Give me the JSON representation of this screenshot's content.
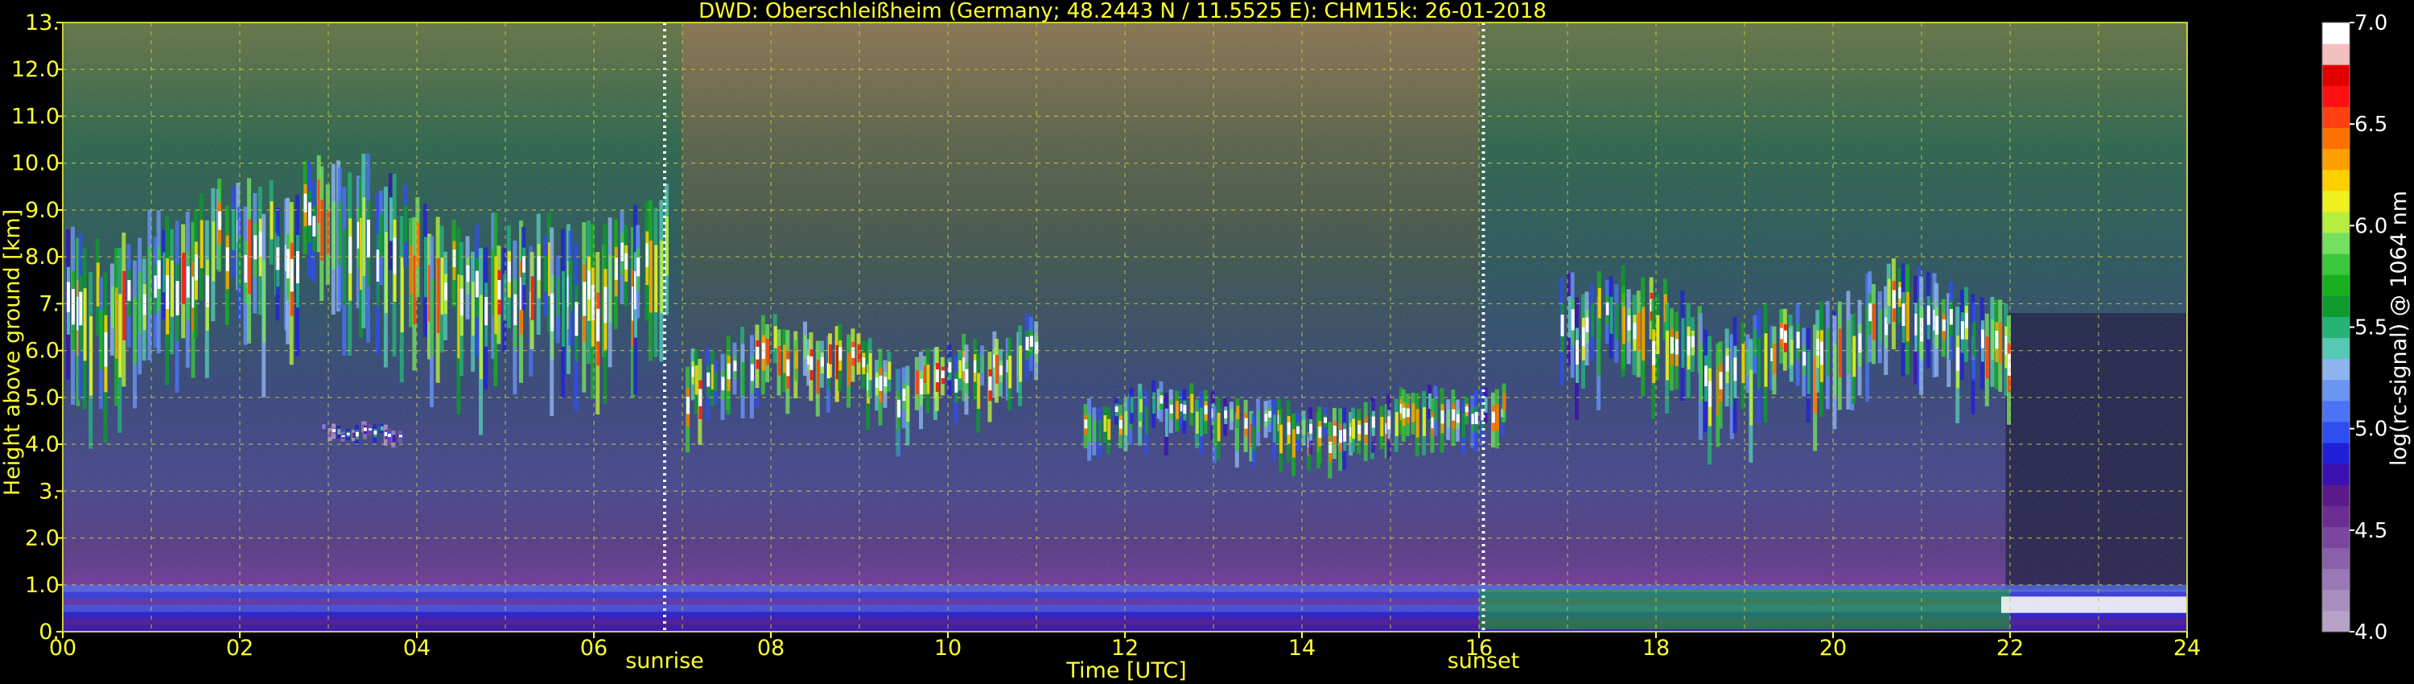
{
  "chart_data": {
    "type": "heatmap",
    "title": "DWD: Oberschleißheim (Germany; 48.2443 N / 11.5525 E):    CHM15k: 26-01-2018",
    "xlabel": "Time [UTC]",
    "ylabel": "Height above ground [km]",
    "xlim": [
      0,
      24
    ],
    "ylim": [
      0,
      13
    ],
    "x_ticks": [
      0,
      2,
      4,
      6,
      8,
      10,
      12,
      14,
      16,
      18,
      20,
      22,
      24
    ],
    "x_tick_labels": [
      "00",
      "02",
      "04",
      "06",
      "08",
      "10",
      "12",
      "14",
      "16",
      "18",
      "20",
      "22",
      "24"
    ],
    "y_ticks": [
      0,
      1,
      2,
      3,
      4,
      5,
      6,
      7,
      8,
      9,
      10,
      11,
      12,
      13
    ],
    "y_tick_labels": [
      "0.",
      "1.0",
      "2.0",
      "3.",
      "4.0",
      "5.0",
      "6.0",
      "7.",
      "8.0",
      "9.0",
      "10.0",
      "11.0",
      "12.0",
      "13."
    ],
    "grid": true,
    "markers": [
      {
        "label": "sunrise",
        "x": 6.8
      },
      {
        "label": "sunset",
        "x": 16.05
      }
    ],
    "colorbar": {
      "label": "log(rc-signal) @ 1064 nm",
      "range": [
        4.0,
        7.0
      ],
      "tick_values": [
        4.0,
        4.5,
        5.0,
        5.5,
        6.0,
        6.5,
        7.0
      ],
      "tick_labels": [
        "4.0",
        "4.5",
        "5.0",
        "5.5",
        "6.0",
        "6.5",
        "7.0"
      ],
      "colors": [
        "#b7a3c8",
        "#a98fbf",
        "#9a78b5",
        "#8a5fab",
        "#7a469f",
        "#6b2d94",
        "#5a1a8a",
        "#3a10b0",
        "#2020d8",
        "#2f4ef0",
        "#4a74f5",
        "#6a95f5",
        "#8fb4f0",
        "#55c9b4",
        "#25b377",
        "#0e9a2c",
        "#19b020",
        "#3cc83c",
        "#74e060",
        "#b6ef3e",
        "#f0f020",
        "#ffd000",
        "#ffa000",
        "#ff7000",
        "#ff4010",
        "#ff1010",
        "#e00000",
        "#f3c0c0",
        "#ffffff"
      ]
    },
    "layers": [
      {
        "name": "boundary-layer",
        "x": [
          0,
          24
        ],
        "y": [
          0.1,
          1.0
        ],
        "value": 5.0
      },
      {
        "name": "cloud-morning",
        "x": [
          0,
          6.8
        ],
        "y": [
          4.0,
          10.8
        ],
        "value": 6.6
      },
      {
        "name": "cloud-midday",
        "x": [
          7.0,
          11.0
        ],
        "y": [
          3.8,
          7.0
        ],
        "value": 6.7
      },
      {
        "name": "cloud-afternoon",
        "x": [
          11.5,
          16.3
        ],
        "y": [
          3.2,
          5.5
        ],
        "value": 6.5
      },
      {
        "name": "cloud-evening",
        "x": [
          16.9,
          22.0
        ],
        "y": [
          3.6,
          8.2
        ],
        "value": 6.6
      },
      {
        "name": "cloud-small-03h",
        "x": [
          2.9,
          3.8
        ],
        "y": [
          3.8,
          4.6
        ],
        "value": 5.6
      }
    ]
  }
}
